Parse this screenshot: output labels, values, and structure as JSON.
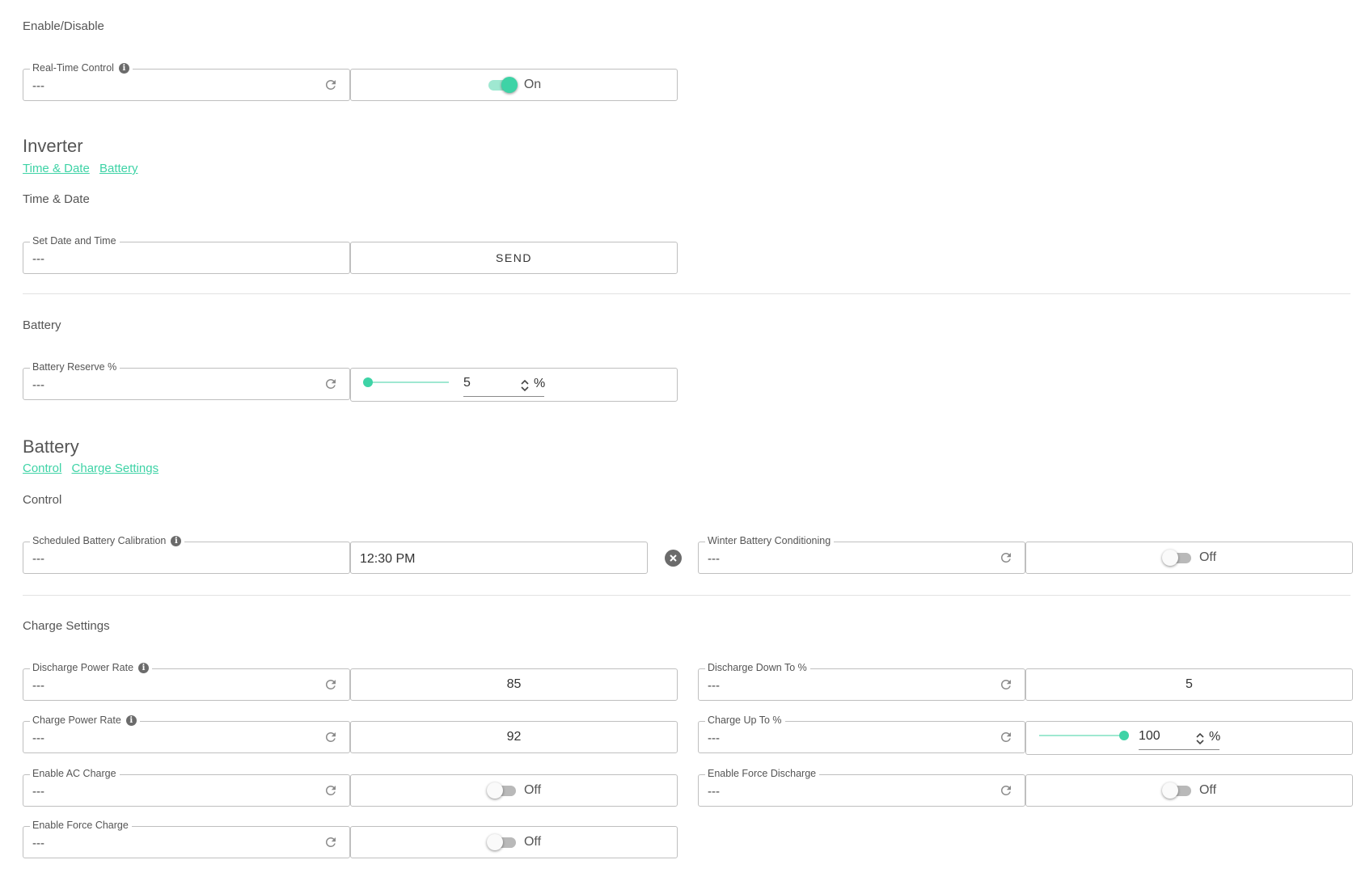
{
  "enable_disable": {
    "heading": "Enable/Disable",
    "real_time_control": {
      "label": "Real-Time Control",
      "value": "---",
      "state": "On"
    }
  },
  "inverter": {
    "title": "Inverter",
    "links": [
      "Time & Date",
      "Battery"
    ],
    "time_date": {
      "heading": "Time & Date",
      "set_date_time": {
        "label": "Set Date and Time",
        "value": "---",
        "button": "SEND"
      }
    },
    "battery": {
      "heading": "Battery",
      "battery_reserve": {
        "label": "Battery Reserve %",
        "value": "---",
        "input": "5",
        "unit": "%",
        "slider_fraction": 0.05
      }
    }
  },
  "battery": {
    "title": "Battery",
    "links": [
      "Control",
      "Charge Settings"
    ],
    "control": {
      "heading": "Control",
      "scheduled_calibration": {
        "label": "Scheduled Battery Calibration",
        "value": "---",
        "time": "12:30 PM"
      },
      "winter_conditioning": {
        "label": "Winter Battery Conditioning",
        "value": "---",
        "state": "Off"
      }
    },
    "charge_settings": {
      "heading": "Charge Settings",
      "discharge_power_rate": {
        "label": "Discharge Power Rate",
        "value": "---",
        "input": "85"
      },
      "discharge_down_to": {
        "label": "Discharge Down To %",
        "value": "---",
        "input": "5"
      },
      "charge_power_rate": {
        "label": "Charge Power Rate",
        "value": "---",
        "input": "92"
      },
      "charge_up_to": {
        "label": "Charge Up To %",
        "value": "---",
        "input": "100",
        "unit": "%",
        "slider_fraction": 1.0
      },
      "enable_ac_charge": {
        "label": "Enable AC Charge",
        "value": "---",
        "state": "Off"
      },
      "enable_force_discharge": {
        "label": "Enable Force Discharge",
        "value": "---",
        "state": "Off"
      },
      "enable_force_charge": {
        "label": "Enable Force Charge",
        "value": "---",
        "state": "Off"
      }
    }
  },
  "colors": {
    "accent": "#3ed3a6",
    "accent_light": "#9fe8d1",
    "border": "#bfbfbf",
    "icon": "#6b6b6b"
  }
}
